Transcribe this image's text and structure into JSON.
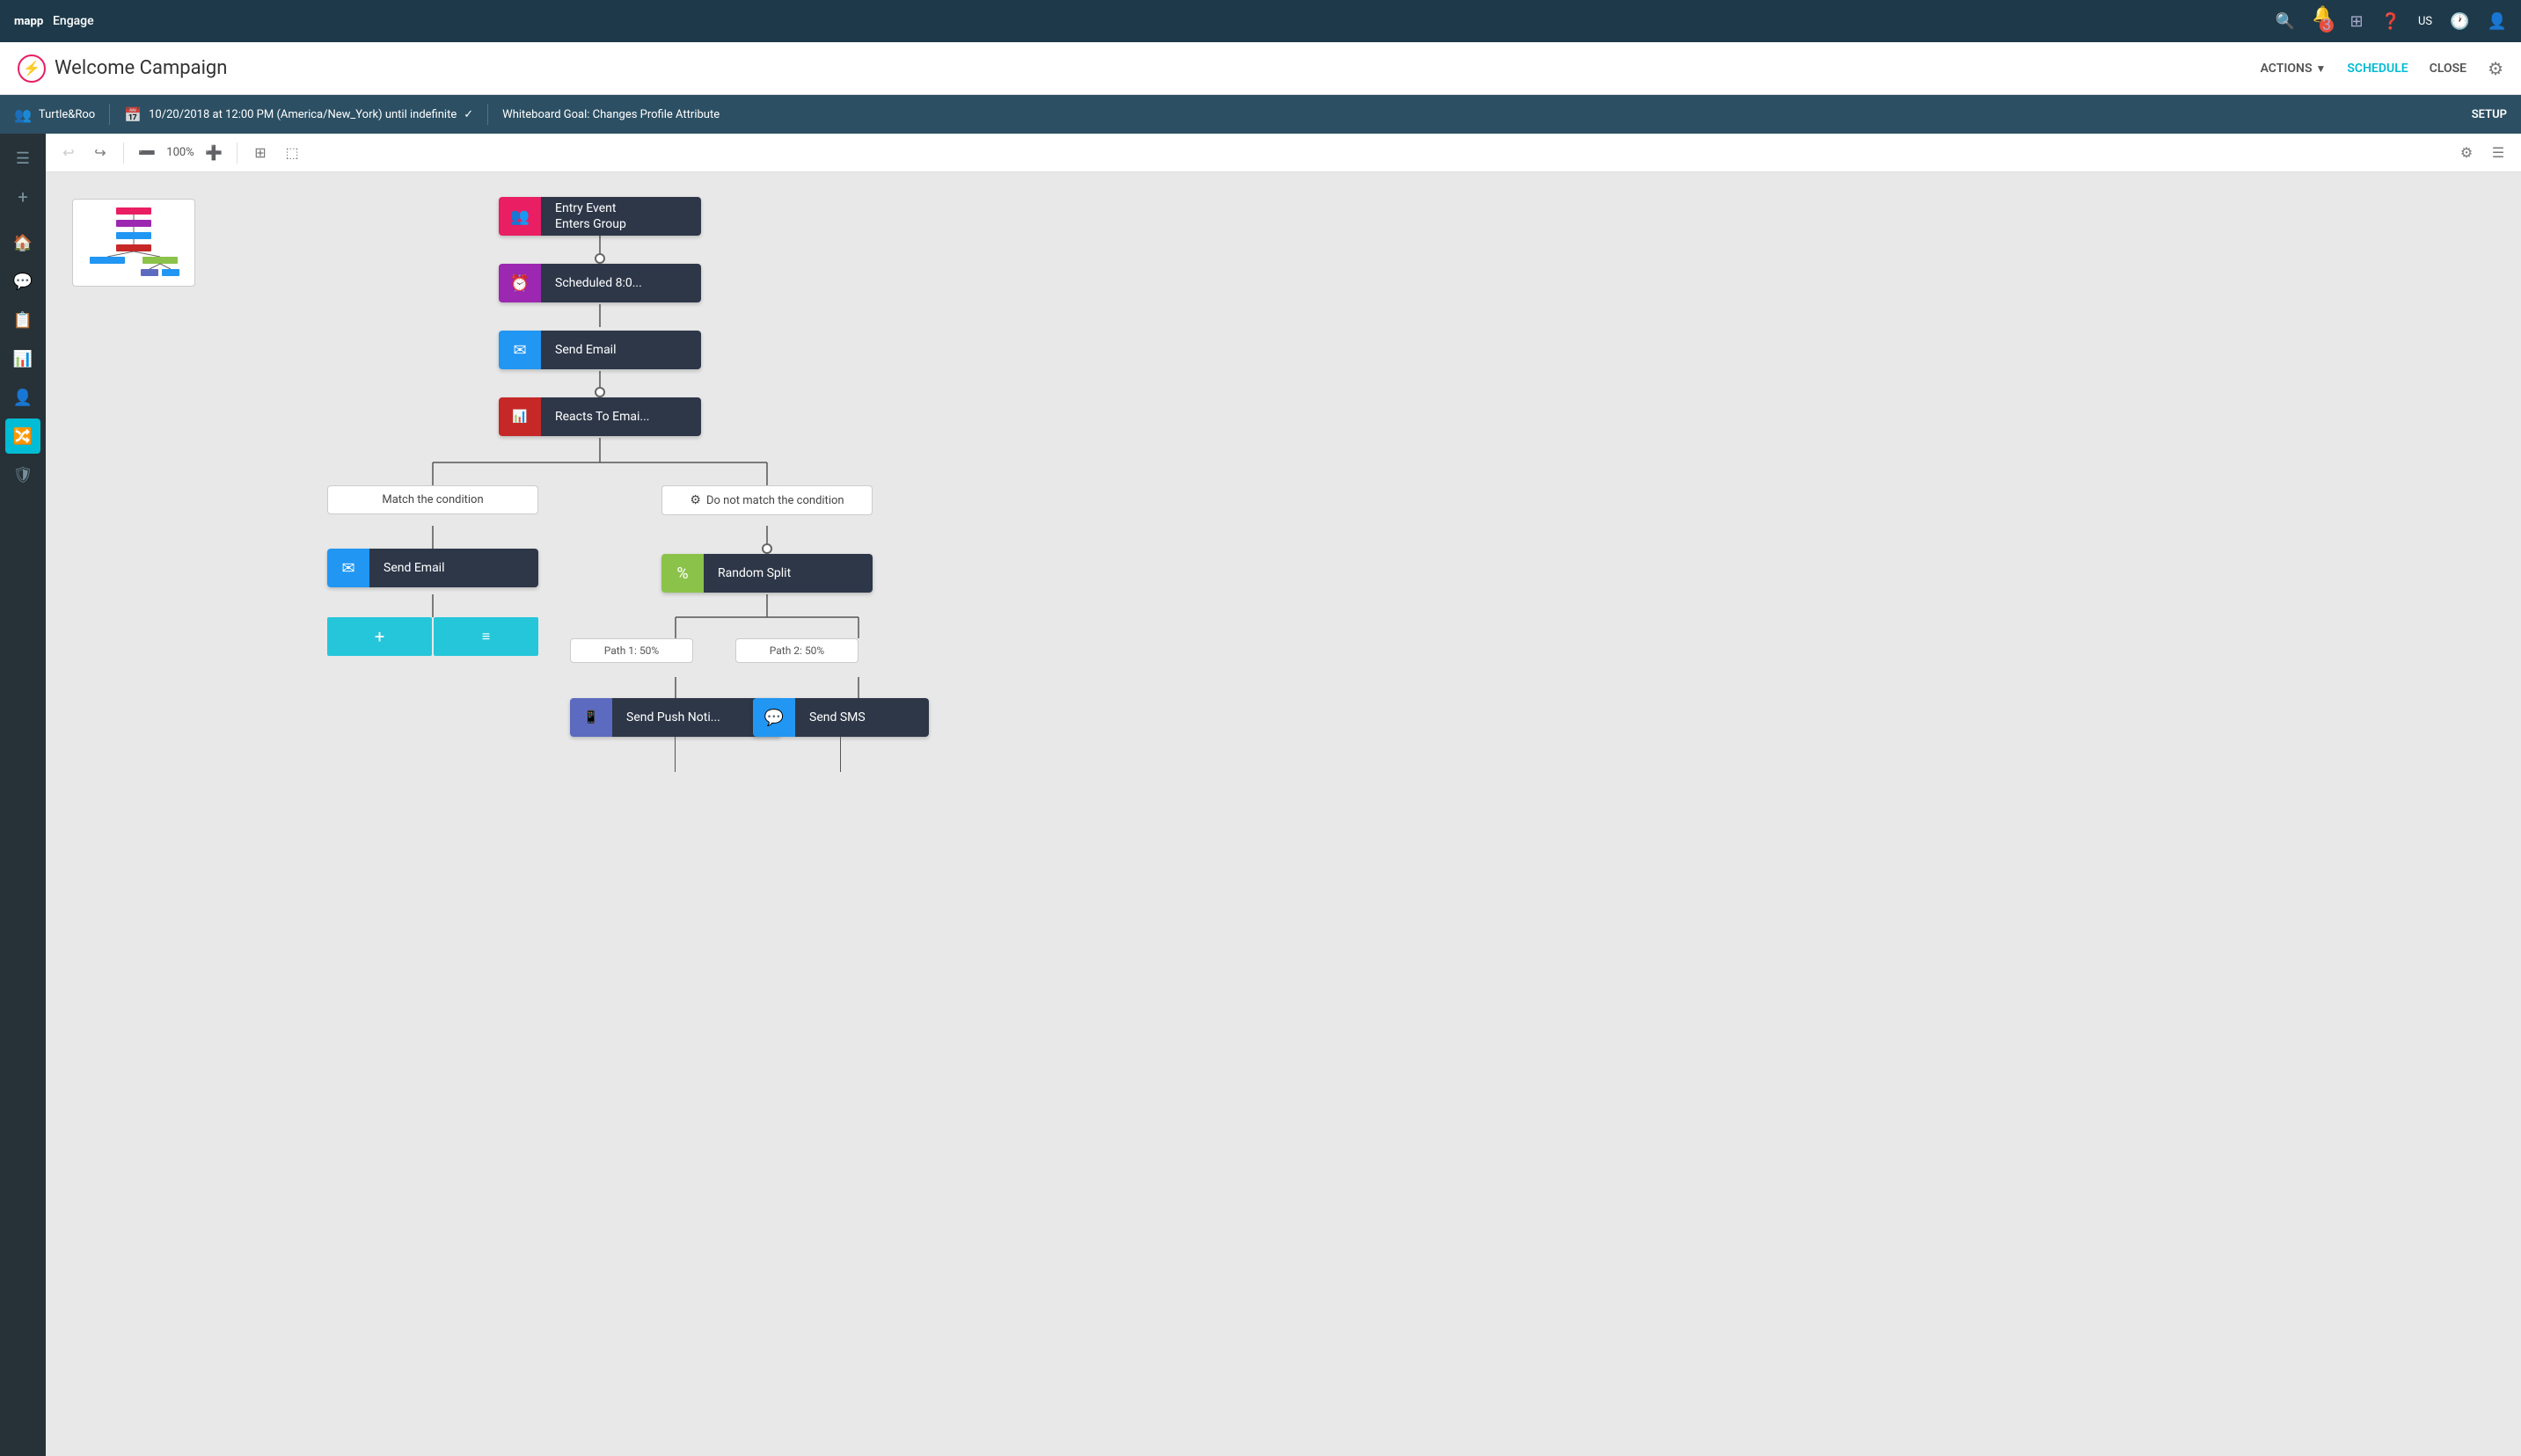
{
  "app": {
    "logo_text": "Engage",
    "nav_icons": [
      "search",
      "bell",
      "grid",
      "help",
      "user-circle",
      "clock",
      "account"
    ]
  },
  "header": {
    "campaign_icon": "⚡",
    "title": "Welcome Campaign",
    "actions_label": "ACTIONS",
    "schedule_label": "SCHEDULE",
    "close_label": "CLOSE"
  },
  "sub_header": {
    "org_name": "Turtle&Roo",
    "schedule": "10/20/2018 at 12:00 PM (America/New_York) until indefinite",
    "goal": "Whiteboard Goal: Changes Profile Attribute",
    "setup_label": "SETUP"
  },
  "toolbar": {
    "zoom_level": "100%"
  },
  "flow": {
    "nodes": [
      {
        "id": "entry",
        "icon": "👥",
        "icon_bg": "#e91e63",
        "label": "Entry Event\nEnters Group",
        "label_line1": "Entry Event",
        "label_line2": "Enters Group"
      },
      {
        "id": "scheduled",
        "icon": "⏰",
        "icon_bg": "#9c27b0",
        "label": "Scheduled 8:0..."
      },
      {
        "id": "send_email_1",
        "icon": "✉",
        "icon_bg": "#2196f3",
        "label": "Send Email"
      },
      {
        "id": "reacts",
        "icon": "📊",
        "icon_bg": "#c62828",
        "label": "Reacts To Emai..."
      },
      {
        "id": "match",
        "label": "Match the condition",
        "type": "branch"
      },
      {
        "id": "no_match",
        "label": "Do not match the condition",
        "type": "branch"
      },
      {
        "id": "send_email_2",
        "icon": "✉",
        "icon_bg": "#2196f3",
        "label": "Send Email"
      },
      {
        "id": "random_split",
        "icon": "%",
        "icon_bg": "#8bc34a",
        "label": "Random Split"
      },
      {
        "id": "path1",
        "label": "Path 1: 50%",
        "type": "path"
      },
      {
        "id": "path2",
        "label": "Path 2: 50%",
        "type": "path"
      },
      {
        "id": "send_push",
        "icon": "📱",
        "icon_bg": "#5c6bc0",
        "label": "Send Push Noti..."
      },
      {
        "id": "send_sms",
        "icon": "💬",
        "icon_bg": "#2196f3",
        "label": "Send SMS"
      }
    ],
    "add_buttons": [
      "+",
      "≡"
    ]
  }
}
